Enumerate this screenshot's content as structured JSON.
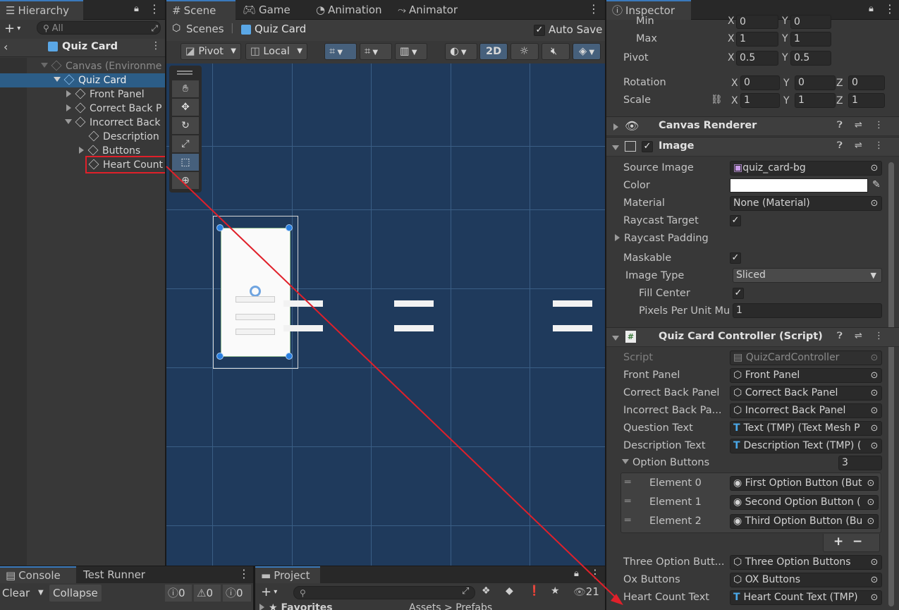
{
  "hierarchy": {
    "tab": "Hierarchy",
    "search_placeholder": "All",
    "breadcrumb": "Quiz Card",
    "items": [
      {
        "label": "Canvas (Environme"
      },
      {
        "label": "Quiz Card"
      },
      {
        "label": "Front Panel"
      },
      {
        "label": "Correct Back P"
      },
      {
        "label": "Incorrect Back"
      },
      {
        "label": "Description"
      },
      {
        "label": "Buttons"
      },
      {
        "label": "Heart Count"
      }
    ]
  },
  "scene": {
    "tabs": [
      {
        "label": "Scene"
      },
      {
        "label": "Game"
      },
      {
        "label": "Animation"
      },
      {
        "label": "Animator"
      }
    ],
    "breadcrumb_root": "Scenes",
    "breadcrumb_current": "Quiz Card",
    "auto_save": "Auto Save",
    "pivot": "Pivot",
    "local": "Local",
    "mode_2d": "2D"
  },
  "inspector": {
    "tab": "Inspector",
    "min_label": "Min",
    "max_label": "Max",
    "pivot_label": "Pivot",
    "rotation_label": "Rotation",
    "scale_label": "Scale",
    "min": {
      "x": "0",
      "y": "0"
    },
    "max": {
      "x": "1",
      "y": "1"
    },
    "pivot": {
      "x": "0.5",
      "y": "0.5"
    },
    "rotation": {
      "x": "0",
      "y": "0",
      "z": "0"
    },
    "scale": {
      "x": "1",
      "y": "1",
      "z": "1"
    },
    "axis": {
      "x": "X",
      "y": "Y",
      "z": "Z"
    },
    "canvas_renderer": "Canvas Renderer",
    "image": {
      "title": "Image",
      "source_image_label": "Source Image",
      "source_image": "quiz_card-bg",
      "color_label": "Color",
      "material_label": "Material",
      "material": "None (Material)",
      "raycast_target_label": "Raycast Target",
      "raycast_padding_label": "Raycast Padding",
      "maskable_label": "Maskable",
      "image_type_label": "Image Type",
      "image_type": "Sliced",
      "fill_center_label": "Fill Center",
      "ppu_label": "Pixels Per Unit Mu",
      "ppu": "1"
    },
    "controller": {
      "title": "Quiz Card Controller (Script)",
      "fields": [
        {
          "label": "Script",
          "value": "QuizCardController"
        },
        {
          "label": "Front Panel",
          "value": "Front Panel"
        },
        {
          "label": "Correct Back Panel",
          "value": "Correct Back Panel"
        },
        {
          "label": "Incorrect Back Pa...",
          "value": "Incorrect Back Panel"
        },
        {
          "label": "Question Text",
          "value": "Text (TMP) (Text Mesh P"
        },
        {
          "label": "Description Text",
          "value": "Description Text (TMP) ("
        }
      ],
      "option_buttons_label": "Option Buttons",
      "option_buttons_count": "3",
      "elements": [
        {
          "label": "Element 0",
          "value": "First Option Button (But"
        },
        {
          "label": "Element 1",
          "value": "Second Option Button ("
        },
        {
          "label": "Element 2",
          "value": "Third Option Button (Bu"
        }
      ],
      "plus": "+",
      "minus": "−",
      "fields2": [
        {
          "label": "Three Option Butt...",
          "value": "Three Option Buttons"
        },
        {
          "label": "Ox Buttons",
          "value": "OX Buttons"
        },
        {
          "label": "Heart Count Text",
          "value": "Heart Count Text (TMP)"
        }
      ]
    }
  },
  "console": {
    "tabs": [
      {
        "label": "Console"
      },
      {
        "label": "Test Runner"
      }
    ],
    "clear": "Clear",
    "collapse": "Collapse",
    "counts": [
      "0",
      "0",
      "0"
    ]
  },
  "project": {
    "tab": "Project",
    "favorites": "Favorites",
    "path": "Assets > Prefabs",
    "hidden_count": "21"
  },
  "colors": {
    "accent": "#3a79bb",
    "scene_bg": "#1f3a5c",
    "highlight": "#e0202a"
  }
}
